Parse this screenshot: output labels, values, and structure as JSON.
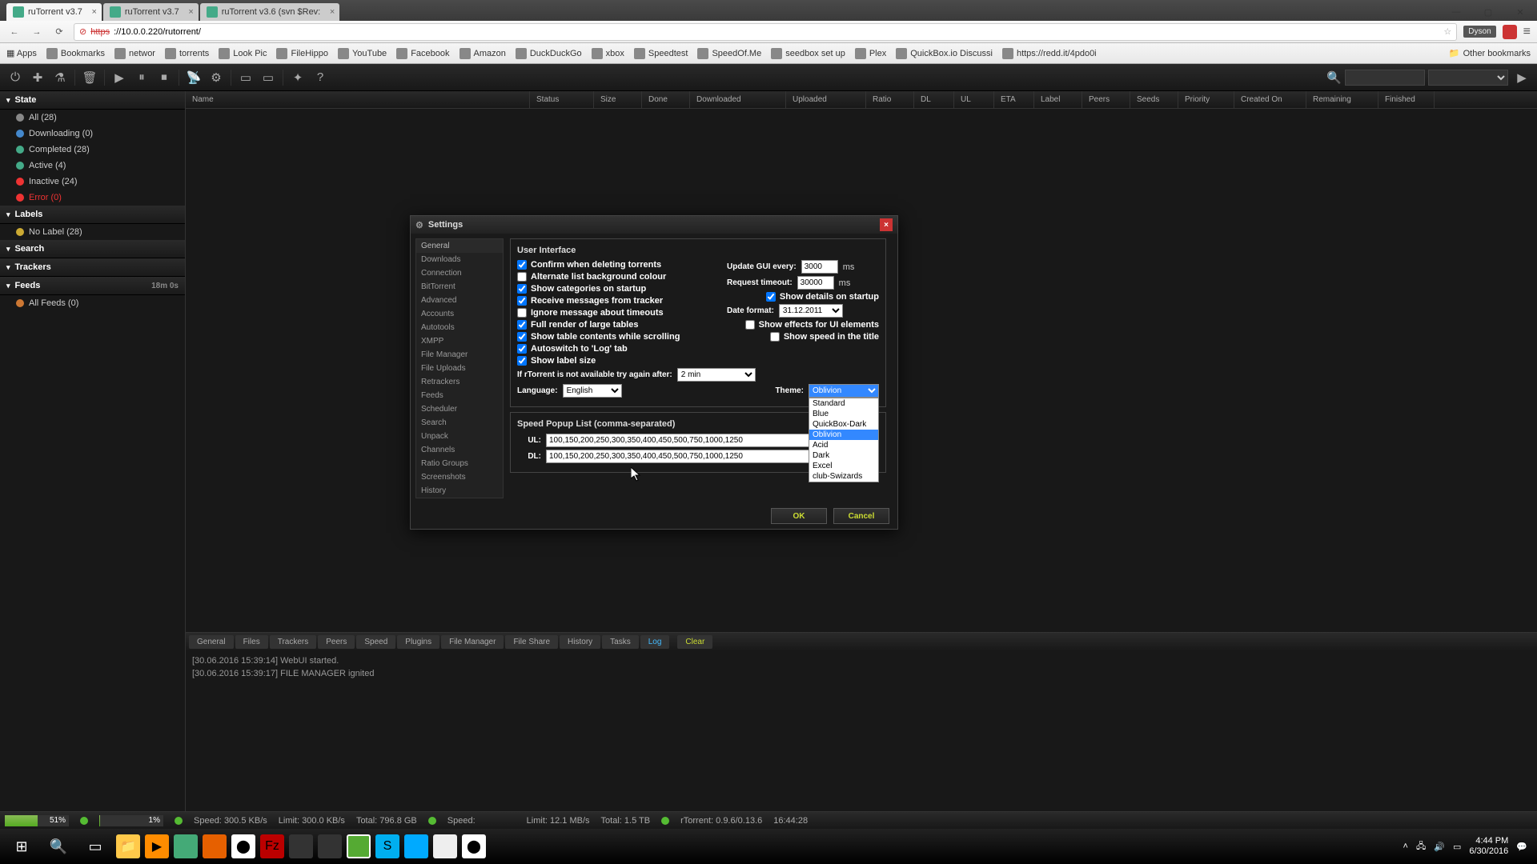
{
  "browser": {
    "tabs": [
      {
        "title": "ruTorrent v3.7",
        "active": true
      },
      {
        "title": "ruTorrent v3.7",
        "active": false
      },
      {
        "title": "ruTorrent v3.6 (svn $Rev:",
        "active": false
      }
    ],
    "url_https": "https",
    "url_rest": "://10.0.0.220/rutorrent/",
    "user_badge": "Dyson",
    "bookmarks": [
      "Bookmarks",
      "networ",
      "torrents",
      "Look Pic",
      "FileHippo",
      "YouTube",
      "Facebook",
      "Amazon",
      "DuckDuckGo",
      "xbox",
      "Speedtest",
      "SpeedOf.Me",
      "seedbox set up",
      "Plex",
      "QuickBox.io Discussi",
      "https://redd.it/4pdo0i"
    ],
    "other_bookmarks": "Other bookmarks"
  },
  "sidebar": {
    "state_header": "State",
    "state_items": [
      {
        "label": "All (28)",
        "dot": "gray"
      },
      {
        "label": "Downloading (0)",
        "dot": "blue"
      },
      {
        "label": "Completed (28)",
        "dot": "green"
      },
      {
        "label": "Active (4)",
        "dot": "green"
      },
      {
        "label": "Inactive (24)",
        "dot": "red"
      },
      {
        "label": "Error (0)",
        "dot": "red",
        "red": true
      }
    ],
    "labels_header": "Labels",
    "labels_items": [
      {
        "label": "No Label (28)"
      }
    ],
    "search_header": "Search",
    "trackers_header": "Trackers",
    "feeds_header": "Feeds",
    "feeds_time": "18m 0s",
    "feeds_items": [
      {
        "label": "All Feeds (0)"
      }
    ]
  },
  "columns": [
    "Name",
    "Status",
    "Size",
    "Done",
    "Downloaded",
    "Uploaded",
    "Ratio",
    "DL",
    "UL",
    "ETA",
    "Label",
    "Peers",
    "Seeds",
    "Priority",
    "Created On",
    "Remaining",
    "Finished"
  ],
  "bottom_tabs": [
    "General",
    "Files",
    "Trackers",
    "Peers",
    "Speed",
    "Plugins",
    "File Manager",
    "File Share",
    "History",
    "Tasks"
  ],
  "bottom_tab_log": "Log",
  "bottom_tab_clear": "Clear",
  "log_lines": [
    "[30.06.2016 15:39:14] WebUI started.",
    "[30.06.2016 15:39:17] FILE MANAGER ignited"
  ],
  "status": {
    "cpu_pct": "51%",
    "hdd_pct": "1%",
    "speed_label": "Speed:",
    "speed_val": "300.5 KB/s",
    "limit_label": "Limit:",
    "limit_val": "300.0 KB/s",
    "total_label": "Total:",
    "total_val": "796.8 GB",
    "speed2_label": "Speed:",
    "speed2_val": "",
    "limit2_label": "Limit:",
    "limit2_val": "12.1 MB/s",
    "total2_label": "Total:",
    "total2_val": "1.5 TB",
    "rtorrent_label": "rTorrent:",
    "rtorrent_val": "0.9.6/0.13.6",
    "time": "16:44:28"
  },
  "settings": {
    "title": "Settings",
    "nav": [
      "General",
      "Downloads",
      "Connection",
      "BitTorrent",
      "Advanced",
      "Accounts",
      "Autotools",
      "XMPP",
      "File Manager",
      "File Uploads",
      "Retrackers",
      "Feeds",
      "Scheduler",
      "Search",
      "Unpack",
      "Channels",
      "Ratio Groups",
      "Screenshots",
      "History"
    ],
    "ui_header": "User Interface",
    "confirm_delete": "Confirm when deleting torrents",
    "alternate_bg": "Alternate list background colour",
    "show_cats": "Show categories on startup",
    "recv_tracker": "Receive messages from tracker",
    "ignore_timeout": "Ignore message about timeouts",
    "full_render": "Full render of large tables",
    "show_scroll": "Show table contents while scrolling",
    "autoswitch": "Autoswitch to 'Log' tab",
    "show_label_size": "Show label size",
    "update_gui": "Update GUI every:",
    "update_gui_val": "3000",
    "ms": "ms",
    "req_timeout": "Request timeout:",
    "req_timeout_val": "30000",
    "show_details": "Show details on startup",
    "date_format": "Date format:",
    "date_format_val": "31.12.2011",
    "show_effects": "Show effects for UI elements",
    "show_speed_title": "Show speed in the title",
    "retry_label": "If rTorrent is not available try again after:",
    "retry_val": "2 min",
    "lang_label": "Language:",
    "lang_val": "English",
    "theme_label": "Theme:",
    "theme_val": "Oblivion",
    "theme_options": [
      "Standard",
      "Blue",
      "QuickBox-Dark",
      "Oblivion",
      "Acid",
      "Dark",
      "Excel",
      "club-Swizards"
    ],
    "speed_header": "Speed Popup List (comma-separated)",
    "ul_label": "UL:",
    "ul_val": "100,150,200,250,300,350,400,450,500,750,1000,1250",
    "dl_label": "DL:",
    "dl_val": "100,150,200,250,300,350,400,450,500,750,1000,1250",
    "ok": "OK",
    "cancel": "Cancel"
  },
  "taskbar": {
    "time": "4:44 PM",
    "date": "6/30/2016"
  }
}
